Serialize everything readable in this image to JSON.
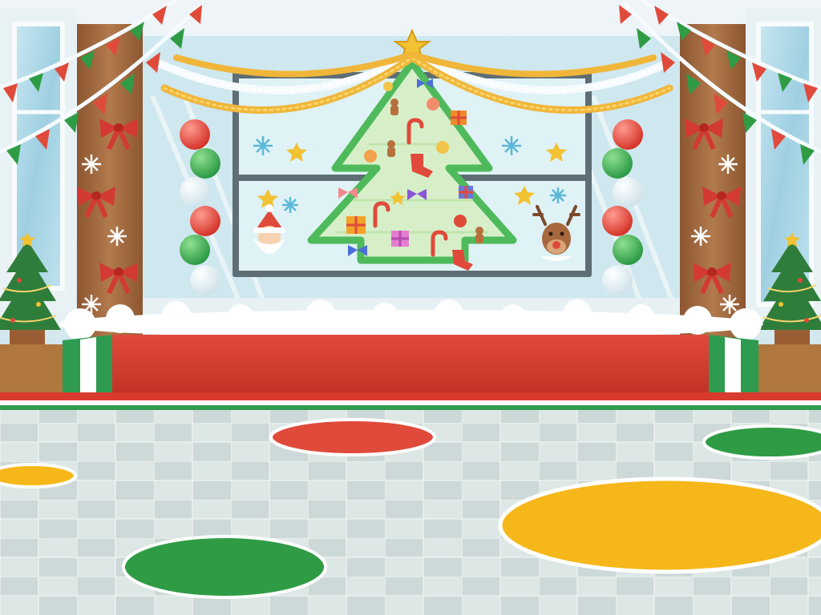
{
  "scene": {
    "type": "game-background",
    "description_visible_text": "",
    "colors": {
      "ceiling": "#eef4f7",
      "wall": "#d5e8ee",
      "wood_pillar": "#a0683f",
      "window_glass": "#9fd0e2",
      "board_frame": "#5e6e74",
      "board_glass": "#dff2f5",
      "tree_green": "#4fba5c",
      "tree_stripe": "#d7efc9",
      "star_gold": "#f1c232",
      "garland_gold": "#f0b63a",
      "garland_white": "#f6fbff",
      "snow": "#ffffff",
      "stage_red": "#d93a2e",
      "stage_red_dark": "#b92b22",
      "stage_green": "#2f9b50",
      "floor_light": "#d9e4e3",
      "floor_dark": "#c3d2d1",
      "spot_red": "#e04a3a",
      "spot_green": "#2f9c45",
      "spot_yellow": "#f6b71a"
    },
    "floor_spots": [
      {
        "color": "red"
      },
      {
        "color": "green"
      },
      {
        "color": "yellow"
      },
      {
        "color": "green"
      },
      {
        "color": "yellow"
      }
    ],
    "decor_icons": [
      "bunting-flags-icon",
      "red-bow-icon",
      "snowflake-icon",
      "balloon-column-icon",
      "christmas-tree-icon",
      "star-icon",
      "candy-cane-icon",
      "gingerbread-icon",
      "stocking-icon",
      "gift-box-icon",
      "santa-face-icon",
      "reindeer-face-icon",
      "ribbon-bow-icon"
    ]
  }
}
